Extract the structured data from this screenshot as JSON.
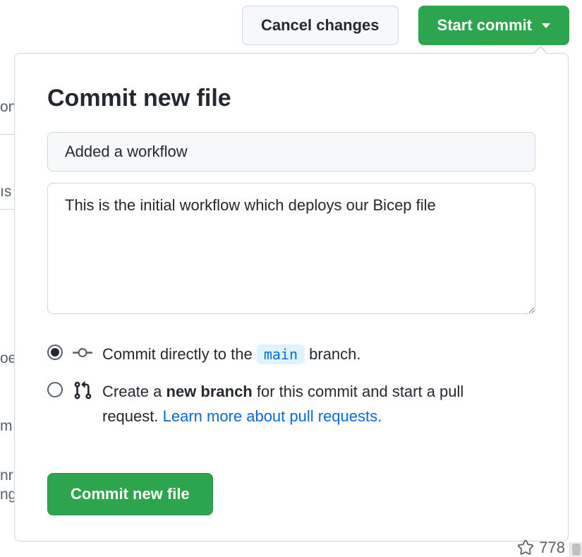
{
  "toolbar": {
    "cancel_label": "Cancel changes",
    "start_commit_label": "Start commit"
  },
  "popover": {
    "title": "Commit new file",
    "summary_value": "Added a workflow",
    "description_value": "This is the initial workflow which deploys our Bicep file",
    "direct": {
      "prefix": "Commit directly to the ",
      "branch": "main",
      "suffix": " branch."
    },
    "newbranch": {
      "text_before": "Create a ",
      "bold": "new branch",
      "text_after": " for this commit and start a pull request. ",
      "link": "Learn more about pull requests."
    },
    "submit_label": "Commit new file"
  },
  "background": {
    "frag1": "on",
    "frag2": "ıs",
    "frag3": "oe",
    "frag4": "m",
    "frag5": "nr\nng",
    "star_count": "778"
  }
}
